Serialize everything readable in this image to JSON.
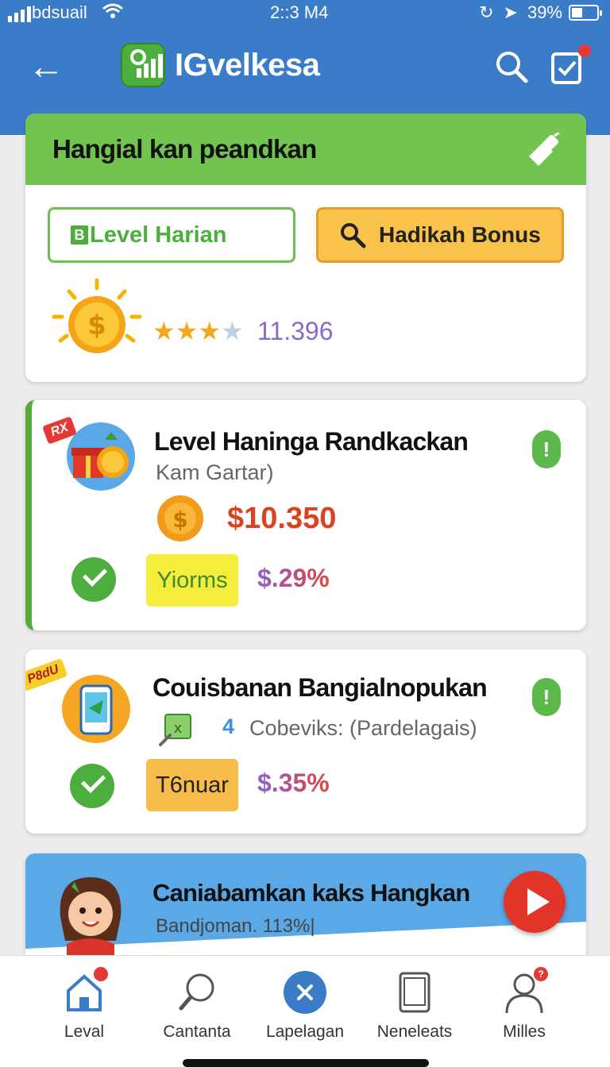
{
  "status_bar": {
    "carrier": "bdsuail",
    "time": "2::3 M4",
    "battery": "39%",
    "battery_level": 0.39
  },
  "header": {
    "title": "IGvelkesa",
    "icons": [
      "back-arrow-icon",
      "chart-logo-icon",
      "search-icon",
      "task-check-icon"
    ],
    "accent": "#3b7cc9"
  },
  "banner": {
    "title": "Hangial kan peandkan",
    "level_button": "Level Harian",
    "level_button_mark": "B",
    "bonus_button": "Hadikah Bonus",
    "rating": 3,
    "rating_max": 4,
    "score": "11.396"
  },
  "items": [
    {
      "tag": "RX",
      "title": "Level Haninga Randkackan",
      "subtitle": "Kam Gartar)",
      "amount": "$10.350",
      "pill": "Yiorms",
      "percent": "$.29%",
      "info": "!"
    },
    {
      "tag": "P8dU",
      "title": "Couisbanan Bangialnopukan",
      "count": "4",
      "subtitle": "Cobeviks: (Pardelagais)",
      "pill": "T6nuar",
      "percent": "$.35%",
      "info": "!"
    }
  ],
  "promo": {
    "title": "Caniabamkan kaks Hangkan",
    "subtitle": "Bandjoman. 113%|"
  },
  "bottom_nav": [
    {
      "label": "Leval",
      "icon": "home-icon",
      "badge": ""
    },
    {
      "label": "Cantanta",
      "icon": "search-icon",
      "badge": ""
    },
    {
      "label": "Lapelagan",
      "icon": "close-circle-icon",
      "badge": ""
    },
    {
      "label": "Neneleats",
      "icon": "tablet-icon",
      "badge": ""
    },
    {
      "label": "Milles",
      "icon": "user-icon",
      "badge": "?"
    }
  ]
}
